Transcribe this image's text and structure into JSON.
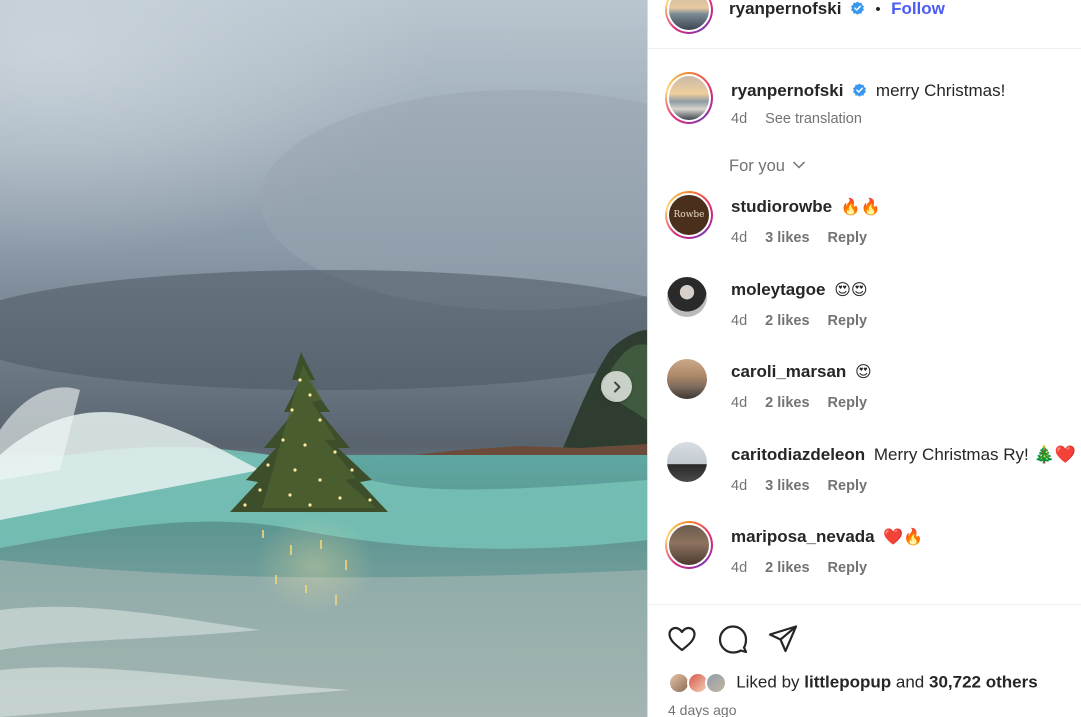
{
  "post": {
    "author": "ryanpernofski",
    "follow_label": "Follow",
    "dot": "•",
    "caption": {
      "username": "ryanpernofski",
      "text": "merry Christmas!",
      "age": "4d",
      "see_translation": "See translation"
    }
  },
  "comments_filter": {
    "label": "For you",
    "icon": "chevron-down-icon"
  },
  "comments": [
    {
      "username": "studiorowbe",
      "text": "🔥🔥",
      "age": "4d",
      "likes": "3 likes",
      "reply": "Reply",
      "avatar_text": "Rowbe"
    },
    {
      "username": "moleytagoe",
      "text": "😍😍",
      "age": "4d",
      "likes": "2 likes",
      "reply": "Reply"
    },
    {
      "username": "caroli_marsan",
      "text": "😍",
      "age": "4d",
      "likes": "2 likes",
      "reply": "Reply"
    },
    {
      "username": "caritodiazdeleon",
      "text": "Merry Christmas Ry! 🎄❤️",
      "age": "4d",
      "likes": "3 likes",
      "reply": "Reply"
    },
    {
      "username": "mariposa_nevada",
      "text": "❤️🔥",
      "age": "4d",
      "likes": "2 likes",
      "reply": "Reply"
    }
  ],
  "engagement": {
    "liked_by_prefix": "Liked by",
    "liked_by_user": "littlepopup",
    "and": "and",
    "others": "30,722 others",
    "posted_ago": "4 days ago"
  },
  "icons": [
    "heart-icon",
    "comment-icon",
    "share-icon",
    "chevron-right-icon",
    "verified-badge-icon"
  ],
  "colors": {
    "accent": "#4a5df9",
    "verified": "#3897f0",
    "meta_text": "#737373"
  }
}
